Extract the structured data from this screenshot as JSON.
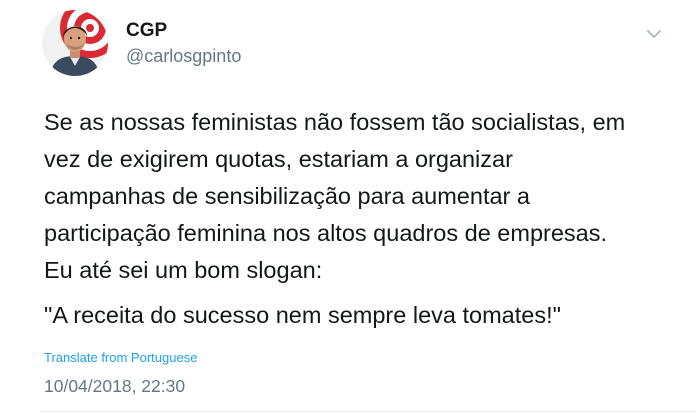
{
  "tweet": {
    "author": {
      "display_name": "CGP",
      "handle": "@carlosgpinto",
      "avatar_icon": "profile-photo"
    },
    "menu_icon": "chevron-down-icon",
    "text": {
      "lines": [
        "Se as nossas feministas não fossem tão socialistas, em",
        "vez de exigirem quotas, estariam a organizar",
        "campanhas de sensibilização para aumentar a",
        "participação feminina nos altos quadros de empresas.",
        "Eu até sei um bom slogan:"
      ],
      "quote": "\"A receita do sucesso nem sempre leva tomates!\""
    },
    "translate_link": "Translate from Portuguese",
    "timestamp": "10/04/2018, 22:30"
  },
  "colors": {
    "text": "#14171a",
    "secondary": "#657786",
    "link": "#1da1f2",
    "divider": "#e6ecf0"
  }
}
